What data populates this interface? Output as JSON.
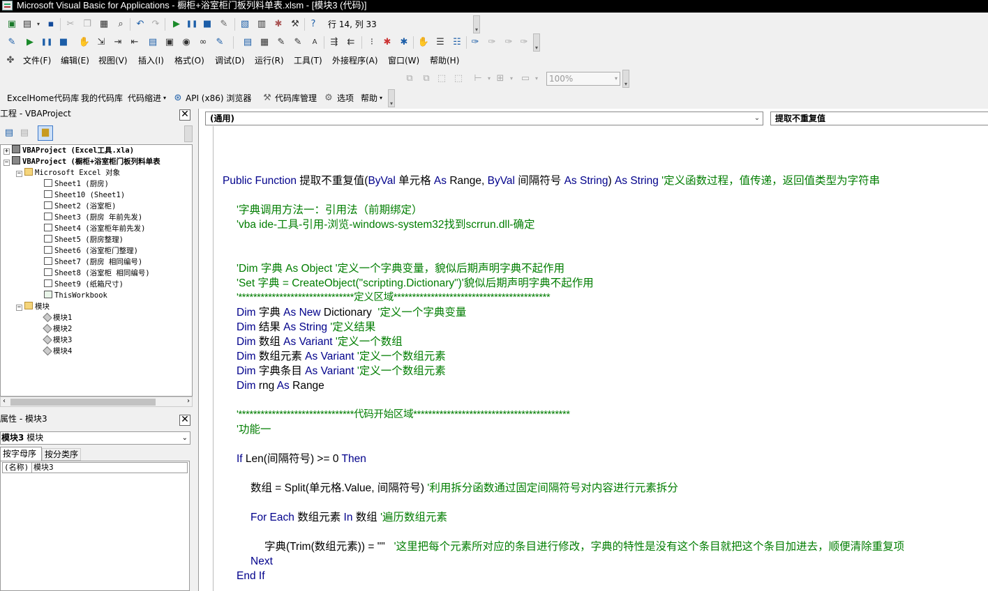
{
  "window": {
    "title": "Microsoft Visual Basic for Applications - 橱柜+浴室柜门板列料单表.xlsm - [模块3 (代码)]"
  },
  "toolbar_std": {
    "position": "行 14, 列 33"
  },
  "menu": [
    "文件(F)",
    "编辑(E)",
    "视图(V)",
    "插入(I)",
    "格式(O)",
    "调试(D)",
    "运行(R)",
    "工具(T)",
    "外接程序(A)",
    "窗口(W)",
    "帮助(H)"
  ],
  "userform_toolbar": {
    "zoom": "100%"
  },
  "addin_bar": [
    "ExcelHome代码库",
    "我的代码库",
    "代码缩进",
    "API (x86) 浏览器",
    "代码库管理",
    "选项",
    "帮助"
  ],
  "project_panel": {
    "title": "工程 - VBAProject",
    "close": "✕",
    "tree": [
      "VBAProject (Excel工具.xla)",
      "VBAProject (橱柜+浴室柜门板列料单表",
      "Microsoft Excel 对象",
      "Sheet1 (厨房)",
      "Sheet10 (Sheet1)",
      "Sheet2 (浴室柜)",
      "Sheet3 (厨房 年前先发)",
      "Sheet4 (浴室柜年前先发)",
      "Sheet5 (厨房整理)",
      "Sheet6 (浴室柜门整理)",
      "Sheet7 (厨房 相同编号)",
      "Sheet8 (浴室柜 相同编号)",
      "Sheet9 (纸箱尺寸)",
      "ThisWorkbook",
      "模块",
      "模块1",
      "模块2",
      "模块3",
      "模块4"
    ]
  },
  "properties_panel": {
    "title": "属性 - 模块3",
    "object_name": "模块3",
    "object_type": "模块",
    "tabs": [
      "按字母序",
      "按分类序"
    ],
    "prop_name": "(名称)",
    "prop_value": "模块3"
  },
  "code_window": {
    "object_combo": "(通用)",
    "proc_combo": "提取不重复值",
    "lines": [
      {
        "parts": [
          [
            "kw",
            "Public Function "
          ],
          [
            "n",
            "提取不重复值("
          ],
          [
            "kw",
            "ByVal "
          ],
          [
            "n",
            "单元格 "
          ],
          [
            "kw",
            "As "
          ],
          [
            "n",
            "Range, "
          ],
          [
            "kw",
            "ByVal "
          ],
          [
            "n",
            "间隔符号 "
          ],
          [
            "kw",
            "As String"
          ],
          [
            "n",
            ") "
          ],
          [
            "kw",
            "As String"
          ],
          [
            "n",
            " "
          ],
          [
            "cm",
            "'定义函数过程，值传递，返回值类型为字符串"
          ]
        ]
      },
      {
        "parts": [
          [
            "cm",
            "'字典调用方法一：引用法（前期绑定）"
          ]
        ]
      },
      {
        "parts": [
          [
            "cm",
            "'vba ide-工具-引用-浏览-windows-system32找到scrrun.dll-确定"
          ]
        ]
      },
      {
        "parts": [
          [
            "cm",
            "'Dim 字典 As Object '定义一个字典变量，貌似后期声明字典不起作用"
          ]
        ]
      },
      {
        "parts": [
          [
            "cm",
            "'Set 字典 = CreateObject(\"scripting.Dictionary\")'貌似后期声明字典不起作用"
          ]
        ]
      },
      {
        "parts": [
          [
            "cm",
            "'*******************************定义区域******************************************"
          ]
        ]
      },
      {
        "parts": [
          [
            "kw",
            "Dim "
          ],
          [
            "n",
            "字典 "
          ],
          [
            "kw",
            "As New "
          ],
          [
            "n",
            "Dictionary  "
          ],
          [
            "cm",
            "'定义一个字典变量"
          ]
        ]
      },
      {
        "parts": [
          [
            "kw",
            "Dim "
          ],
          [
            "n",
            "结果 "
          ],
          [
            "kw",
            "As String "
          ],
          [
            "cm",
            "'定义结果"
          ]
        ]
      },
      {
        "parts": [
          [
            "kw",
            "Dim "
          ],
          [
            "n",
            "数组 "
          ],
          [
            "kw",
            "As Variant "
          ],
          [
            "cm",
            "'定义一个数组"
          ]
        ]
      },
      {
        "parts": [
          [
            "kw",
            "Dim "
          ],
          [
            "n",
            "数组元素 "
          ],
          [
            "kw",
            "As Variant "
          ],
          [
            "cm",
            "'定义一个数组元素"
          ]
        ]
      },
      {
        "parts": [
          [
            "kw",
            "Dim "
          ],
          [
            "n",
            "字典条目 "
          ],
          [
            "kw",
            "As Variant "
          ],
          [
            "cm",
            "'定义一个数组元素"
          ]
        ]
      },
      {
        "parts": [
          [
            "kw",
            "Dim "
          ],
          [
            "n",
            "rng "
          ],
          [
            "kw",
            "As "
          ],
          [
            "n",
            "Range"
          ]
        ]
      },
      {
        "parts": [
          [
            "cm",
            "'*******************************代码开始区域******************************************"
          ]
        ]
      },
      {
        "parts": [
          [
            "cm",
            "'功能一"
          ]
        ]
      },
      {
        "parts": [
          [
            "kw",
            "If "
          ],
          [
            "n",
            "Len(间隔符号) >= 0 "
          ],
          [
            "kw",
            "Then"
          ]
        ]
      },
      {
        "parts": [
          [
            "n",
            "数组 = Split(单元格.Value, 间隔符号) "
          ],
          [
            "cm",
            "'利用拆分函数通过固定间隔符号对内容进行元素拆分"
          ]
        ]
      },
      {
        "parts": [
          [
            "kw",
            "For Each "
          ],
          [
            "n",
            "数组元素 "
          ],
          [
            "kw",
            "In "
          ],
          [
            "n",
            "数组 "
          ],
          [
            "cm",
            "'遍历数组元素"
          ]
        ]
      },
      {
        "parts": [
          [
            "n",
            "字典(Trim(数组元素)) = \"\"   "
          ],
          [
            "cm",
            "'这里把每个元素所对应的条目进行修改，字典的特性是没有这个条目就把这个条目加进去，顺便清除重复项"
          ]
        ]
      },
      {
        "parts": [
          [
            "kw",
            "Next"
          ]
        ]
      },
      {
        "parts": [
          [
            "kw",
            "End If"
          ]
        ]
      }
    ]
  }
}
